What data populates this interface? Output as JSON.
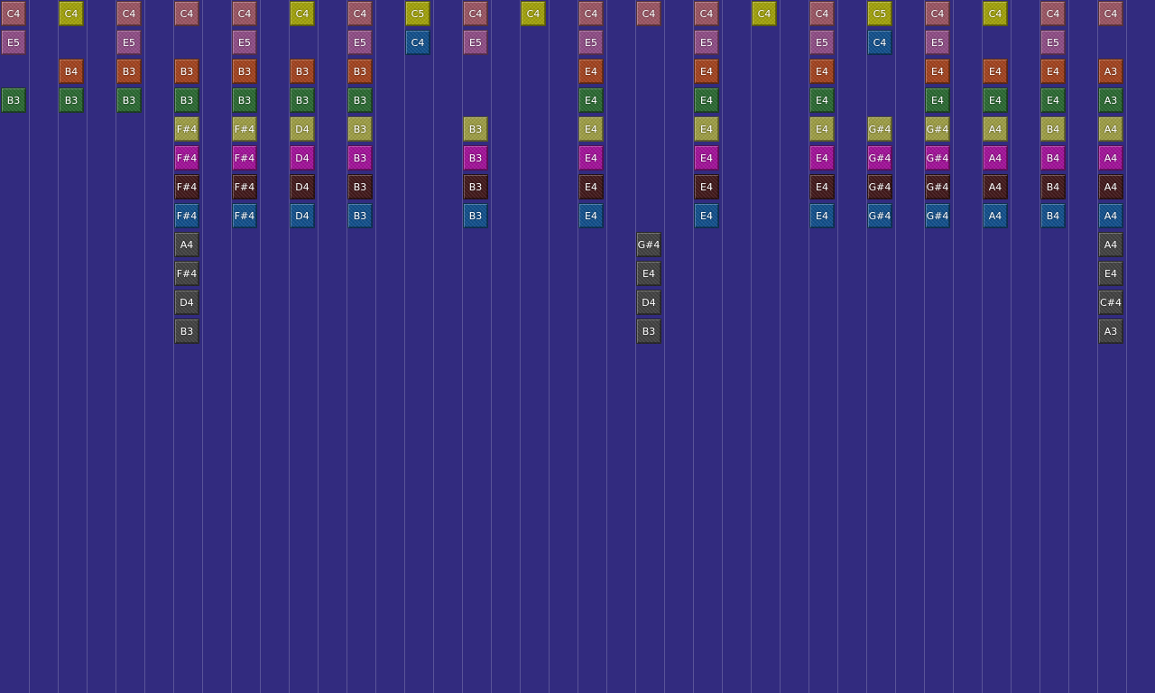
{
  "palette": {
    "background": "#322b7f",
    "gridline": "#5a5498",
    "tile_colors": {
      "salmon": "#9b5563",
      "olive": "#a3a30b",
      "plum": "#8f4d86",
      "orange": "#a3431f",
      "green": "#2b6a32",
      "khaki": "#9e9e45",
      "magenta": "#a3129a",
      "maroon": "#42191b",
      "blue": "#12508c",
      "gray": "#424242"
    }
  },
  "rows": [
    {
      "color": "salmon",
      "notes": [
        "C4",
        null,
        "C4",
        "C4",
        "C4",
        null,
        "C4",
        null,
        "C4",
        null,
        "C4",
        "C4",
        "C4",
        null,
        "C4",
        null,
        "C4",
        null,
        "C4",
        "C4"
      ]
    },
    {
      "color": "olive",
      "notes": [
        null,
        "C4",
        null,
        null,
        null,
        "C4",
        null,
        "C5",
        null,
        "C4",
        null,
        null,
        null,
        "C4",
        null,
        "C5",
        null,
        "C4",
        null,
        null
      ]
    },
    {
      "color": "plum",
      "notes": [
        "E5",
        null,
        "E5",
        null,
        "E5",
        null,
        "E5",
        null,
        "E5",
        null,
        "E5",
        null,
        "E5",
        null,
        "E5",
        null,
        "E5",
        null,
        "E5",
        null
      ]
    },
    {
      "color": "blue",
      "notes": [
        null,
        null,
        null,
        null,
        null,
        null,
        null,
        "C4",
        null,
        null,
        null,
        null,
        null,
        null,
        null,
        "C4",
        null,
        null,
        null,
        null
      ]
    },
    {
      "color": "orange",
      "notes": [
        null,
        "B4",
        "B3",
        "B3",
        "B3",
        "B3",
        "B3",
        null,
        null,
        null,
        "E4",
        null,
        "E4",
        null,
        "E4",
        null,
        "E4",
        "E4",
        "E4",
        "A3"
      ]
    },
    {
      "color": "green",
      "notes": [
        "B3",
        "B3",
        "B3",
        "B3",
        "B3",
        "B3",
        "B3",
        null,
        null,
        null,
        "E4",
        null,
        "E4",
        null,
        "E4",
        null,
        "E4",
        "E4",
        "E4",
        "A3"
      ]
    },
    {
      "color": "khaki",
      "notes": [
        null,
        null,
        null,
        "F#4",
        "F#4",
        "D4",
        "B3",
        null,
        "B3",
        null,
        "E4",
        null,
        "E4",
        null,
        "E4",
        "G#4",
        "G#4",
        "A4",
        "B4",
        "A4"
      ]
    },
    {
      "color": "magenta",
      "notes": [
        null,
        null,
        null,
        "F#4",
        "F#4",
        "D4",
        "B3",
        null,
        "B3",
        null,
        "E4",
        null,
        "E4",
        null,
        "E4",
        "G#4",
        "G#4",
        "A4",
        "B4",
        "A4"
      ]
    },
    {
      "color": "maroon",
      "notes": [
        null,
        null,
        null,
        "F#4",
        "F#4",
        "D4",
        "B3",
        null,
        "B3",
        null,
        "E4",
        null,
        "E4",
        null,
        "E4",
        "G#4",
        "G#4",
        "A4",
        "B4",
        "A4"
      ]
    },
    {
      "color": "blue",
      "notes": [
        null,
        null,
        null,
        "F#4",
        "F#4",
        "D4",
        "B3",
        null,
        "B3",
        null,
        "E4",
        null,
        "E4",
        null,
        "E4",
        "G#4",
        "G#4",
        "A4",
        "B4",
        "A4"
      ]
    },
    {
      "color": "gray",
      "notes": [
        null,
        null,
        null,
        "A4",
        null,
        null,
        null,
        null,
        null,
        null,
        null,
        "G#4",
        null,
        null,
        null,
        null,
        null,
        null,
        null,
        "A4"
      ]
    },
    {
      "color": "gray",
      "notes": [
        null,
        null,
        null,
        "F#4",
        null,
        null,
        null,
        null,
        null,
        null,
        null,
        "E4",
        null,
        null,
        null,
        null,
        null,
        null,
        null,
        "E4"
      ]
    },
    {
      "color": "gray",
      "notes": [
        null,
        null,
        null,
        "D4",
        null,
        null,
        null,
        null,
        null,
        null,
        null,
        "D4",
        null,
        null,
        null,
        null,
        null,
        null,
        null,
        "C#4"
      ]
    },
    {
      "color": "gray",
      "notes": [
        null,
        null,
        null,
        "B3",
        null,
        null,
        null,
        null,
        null,
        null,
        null,
        "B3",
        null,
        null,
        null,
        null,
        null,
        null,
        null,
        "A3"
      ]
    }
  ]
}
